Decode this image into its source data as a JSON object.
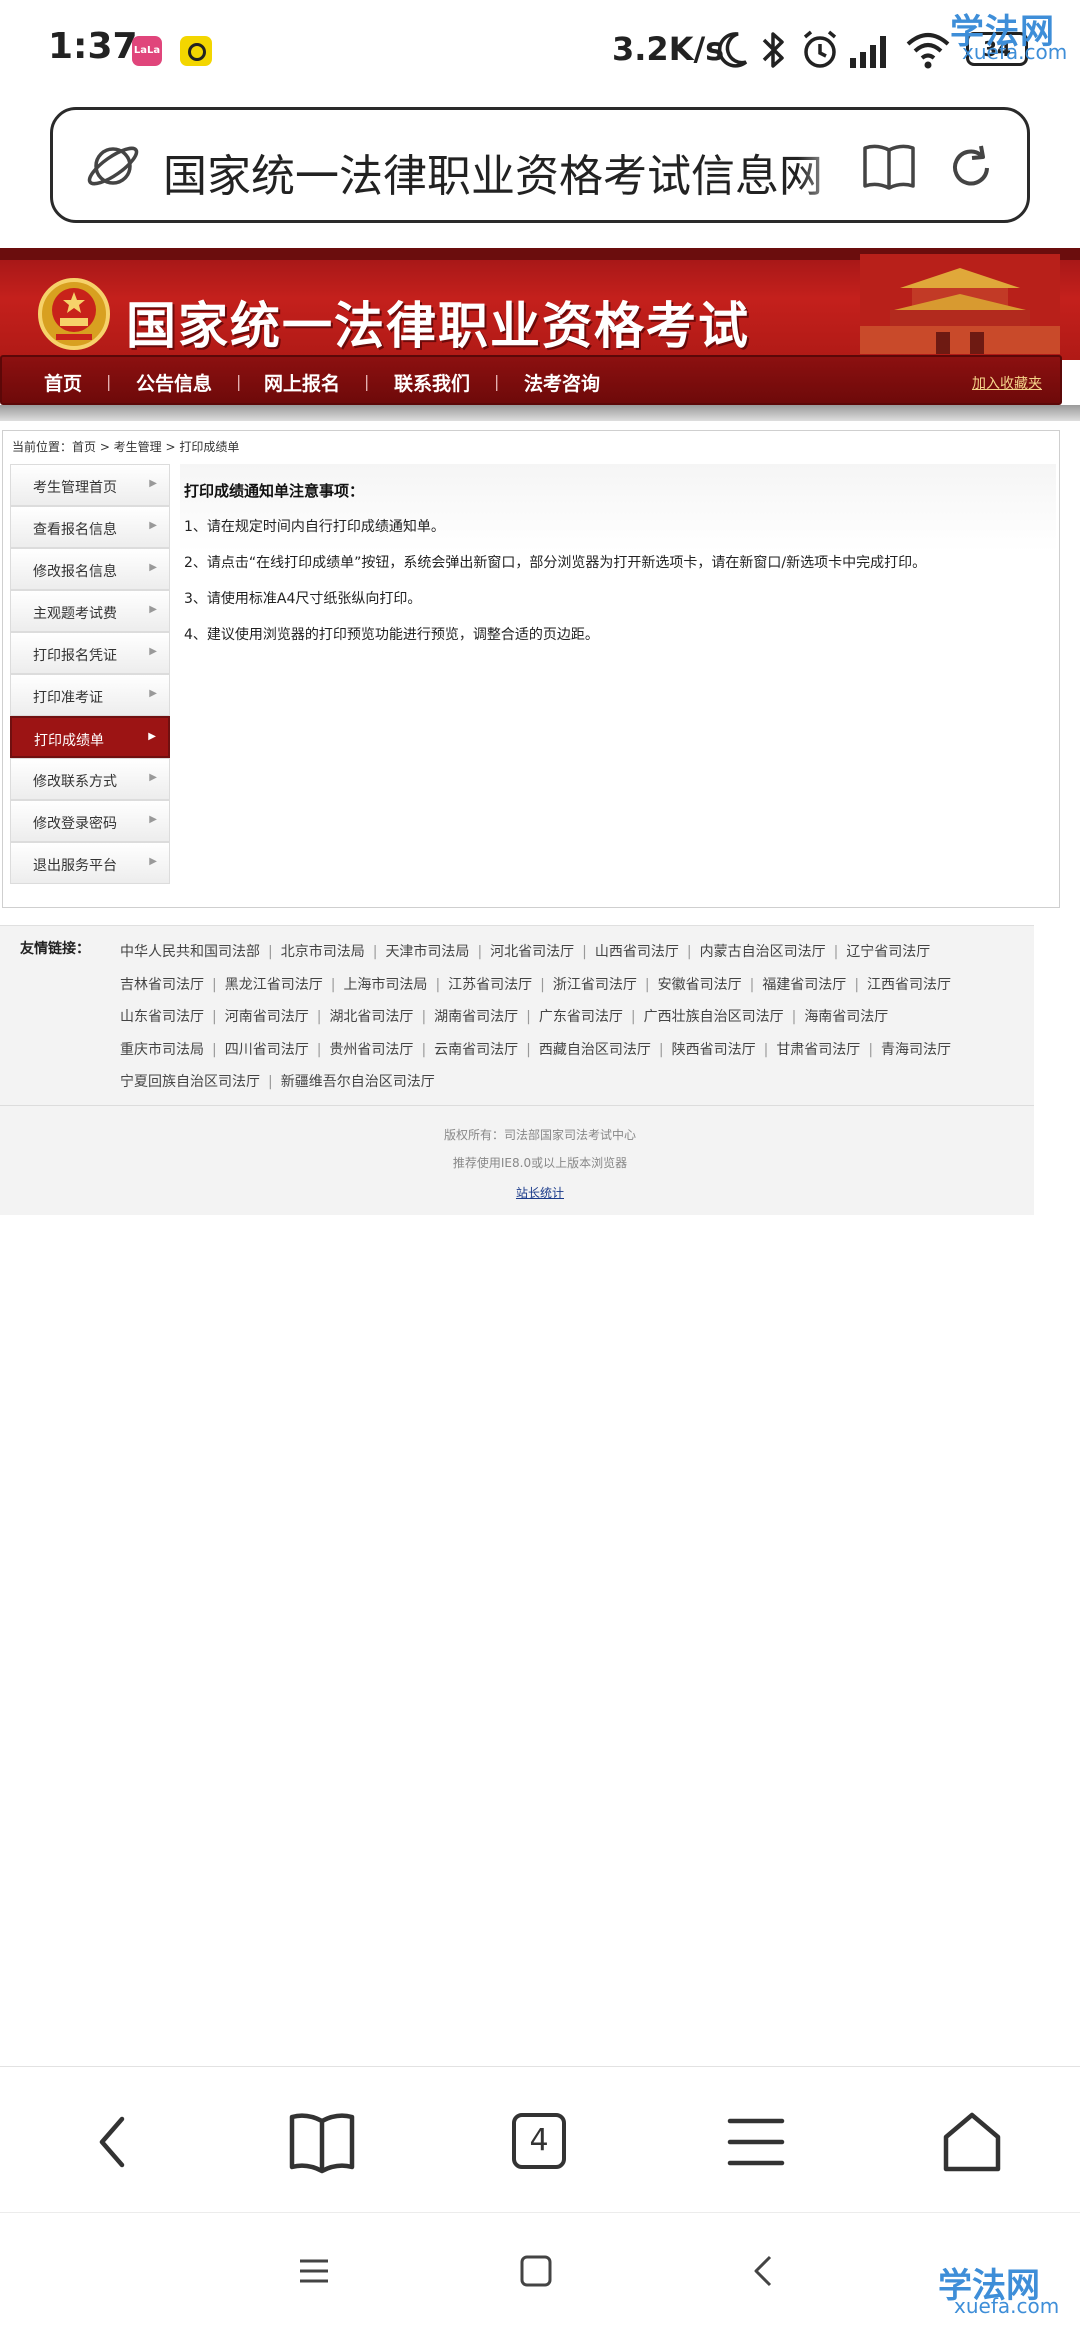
{
  "status_bar": {
    "time": "1:37",
    "net_speed": "3.2K/s",
    "battery": "34",
    "icons": [
      "app-icon-pink",
      "app-icon-yellow",
      "moon-icon",
      "bluetooth-icon",
      "alarm-icon",
      "signal-icon",
      "wifi-icon",
      "battery-icon"
    ]
  },
  "watermark": {
    "name": "学法网",
    "domain": "xuefa.com"
  },
  "url_bar": {
    "text": "国家统一法律职业资格考试信息网"
  },
  "site": {
    "title": "国家统一法律职业资格考试",
    "nav": [
      "首页",
      "公告信息",
      "网上报名",
      "联系我们",
      "法考咨询"
    ],
    "nav_separator": "|",
    "favorite": "加入收藏夹"
  },
  "breadcrumb": "当前位置：首页 > 考生管理 > 打印成绩单",
  "sidebar": {
    "items": [
      {
        "label": "考生管理首页"
      },
      {
        "label": "查看报名信息"
      },
      {
        "label": "修改报名信息"
      },
      {
        "label": "主观题考试费"
      },
      {
        "label": "打印报名凭证"
      },
      {
        "label": "打印准考证"
      },
      {
        "label": "打印成绩单",
        "active": true
      },
      {
        "label": "修改联系方式"
      },
      {
        "label": "修改登录密码"
      },
      {
        "label": "退出服务平台"
      }
    ]
  },
  "notice": {
    "title": "打印成绩通知单注意事项：",
    "items": [
      "1、请在规定时间内自行打印成绩通知单。",
      "2、请点击“在线打印成绩单”按钮，系统会弹出新窗口，部分浏览器为打开新选项卡，请在新窗口/新选项卡中完成打印。",
      "3、请使用标准A4尺寸纸张纵向打印。",
      "4、建议使用浏览器的打印预览功能进行预览，调整合适的页边距。"
    ]
  },
  "links": {
    "label": "友情链接：",
    "items": [
      "中华人民共和国司法部",
      "北京市司法局",
      "天津市司法局",
      "河北省司法厅",
      "山西省司法厅",
      "内蒙古自治区司法厅",
      "辽宁省司法厅",
      "吉林省司法厅",
      "黑龙江省司法厅",
      "上海市司法局",
      "江苏省司法厅",
      "浙江省司法厅",
      "安徽省司法厅",
      "福建省司法厅",
      "江西省司法厅",
      "山东省司法厅",
      "河南省司法厅",
      "湖北省司法厅",
      "湖南省司法厅",
      "广东省司法厅",
      "广西壮族自治区司法厅",
      "海南省司法厅",
      "重庆市司法局",
      "四川省司法厅",
      "贵州省司法厅",
      "云南省司法厅",
      "西藏自治区司法厅",
      "陕西省司法厅",
      "甘肃省司法厅",
      "青海司法厅",
      "宁夏回族自治区司法厅",
      "新疆维吾尔自治区司法厅"
    ],
    "rows": [
      7,
      8,
      7,
      8,
      2
    ],
    "separator": "|"
  },
  "footer": {
    "copyright": "版权所有：司法部国家司法考试中心",
    "browser": "推荐使用IE8.0或以上版本浏览器",
    "stats": "站长统计"
  },
  "toolbar": {
    "tab_count": "4",
    "icons": [
      "back-icon",
      "bookmarks-icon",
      "tabs-icon",
      "menu-icon",
      "home-icon"
    ]
  },
  "system_nav": {
    "icons": [
      "recents-icon",
      "home-square-icon",
      "back-triangle-icon"
    ]
  }
}
